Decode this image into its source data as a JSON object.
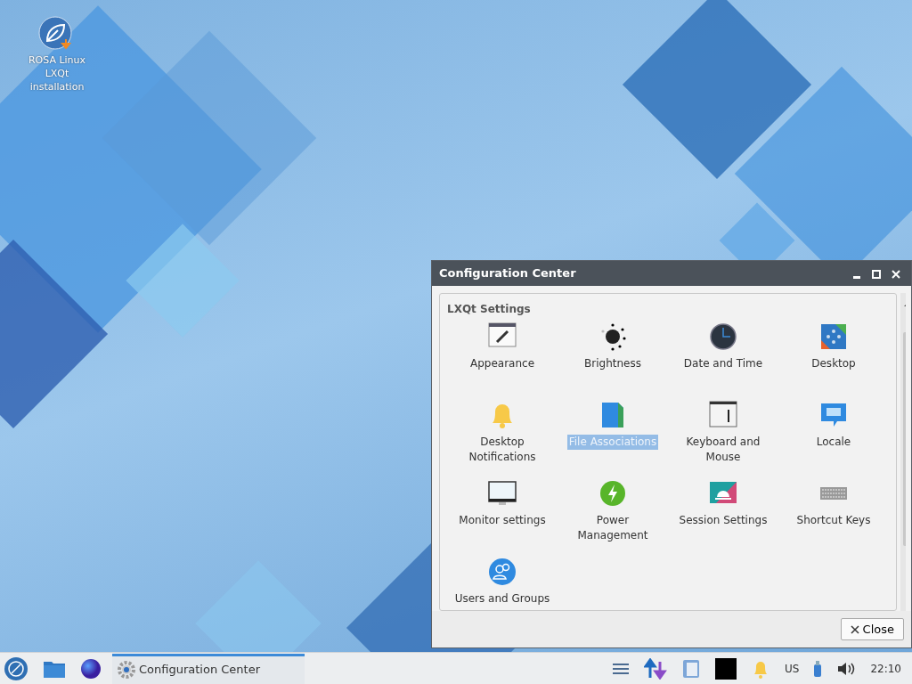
{
  "desktop_icons": [
    {
      "label": "ROSA Linux LXQt installation"
    }
  ],
  "window": {
    "title": "Configuration Center",
    "section": "LXQt Settings",
    "items": [
      {
        "label": "Appearance",
        "selected": false
      },
      {
        "label": "Brightness",
        "selected": false
      },
      {
        "label": "Date and Time",
        "selected": false
      },
      {
        "label": "Desktop",
        "selected": false
      },
      {
        "label": "Desktop Notifications",
        "selected": false
      },
      {
        "label": "File Associations",
        "selected": true
      },
      {
        "label": "Keyboard and Mouse",
        "selected": false
      },
      {
        "label": "Locale",
        "selected": false
      },
      {
        "label": "Monitor settings",
        "selected": false
      },
      {
        "label": "Power Management",
        "selected": false
      },
      {
        "label": "Session Settings",
        "selected": false
      },
      {
        "label": "Shortcut Keys",
        "selected": false
      },
      {
        "label": "Users and Groups",
        "selected": false
      }
    ],
    "close_button": "Close"
  },
  "taskbar": {
    "tasks": [
      {
        "label": "Configuration Center",
        "selected": true
      }
    ],
    "keyboard_layout": "US",
    "clock": "22:10"
  }
}
